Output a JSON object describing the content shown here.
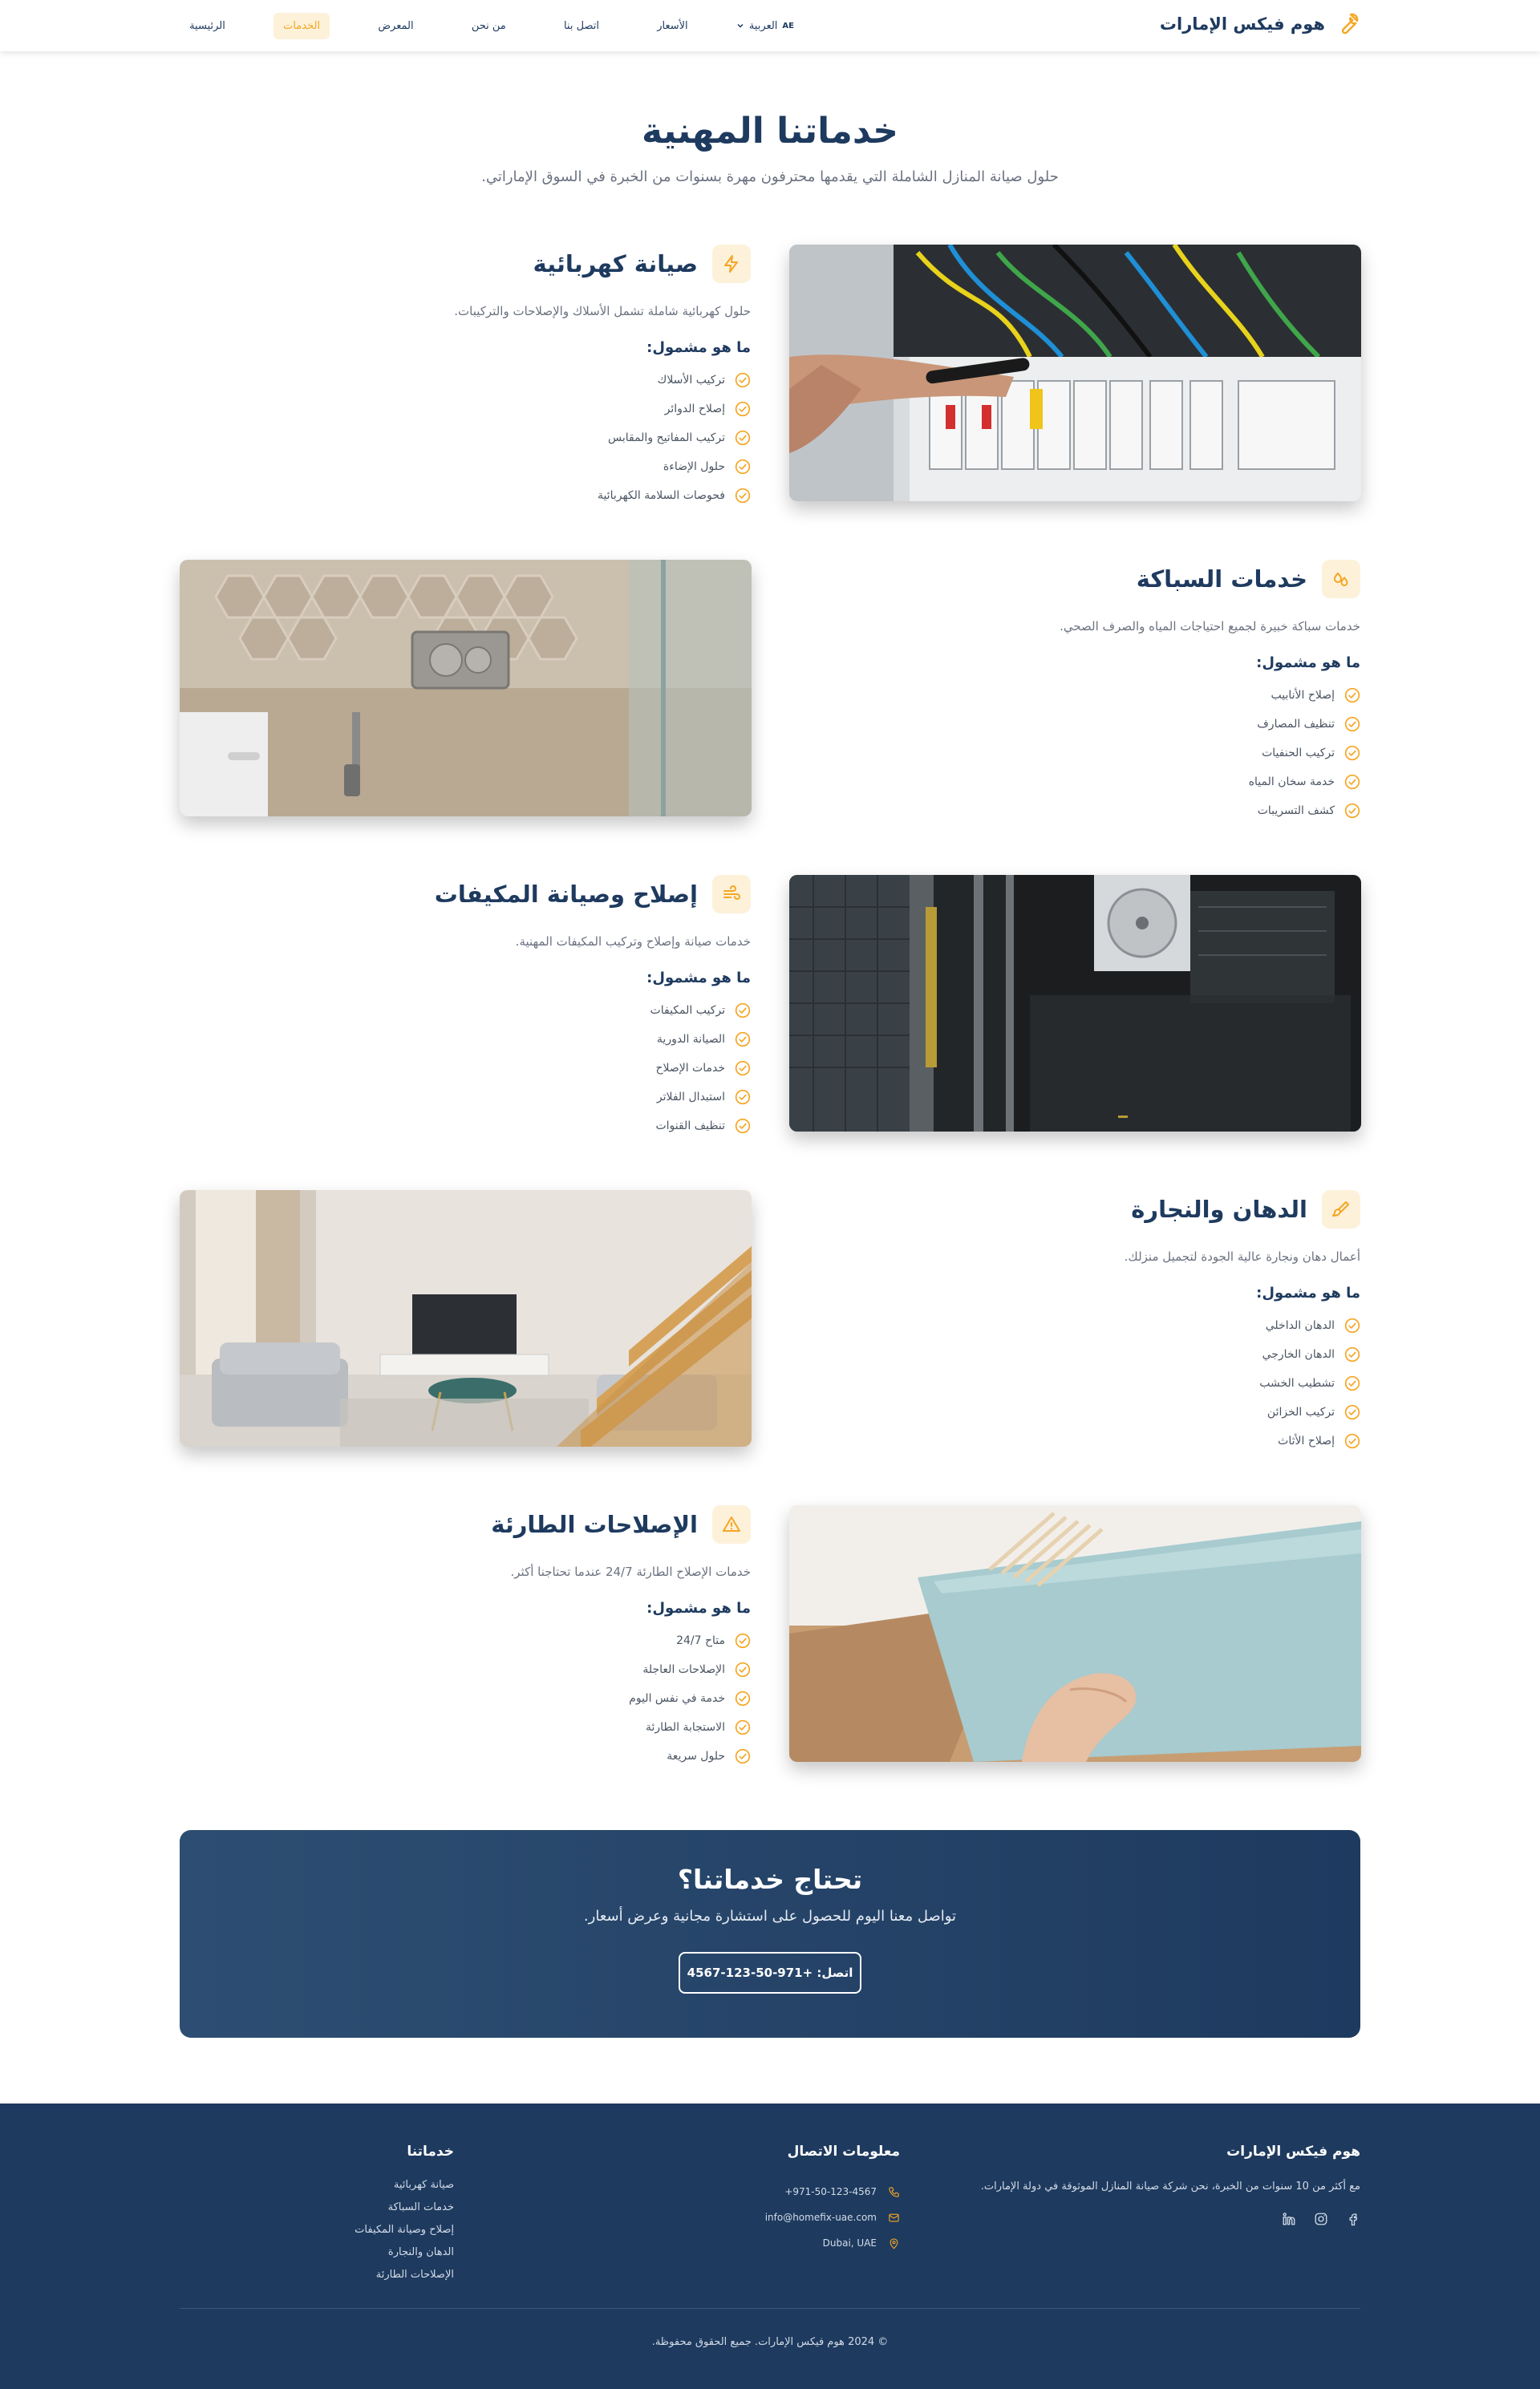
{
  "nav": {
    "brand": "هوم فيكس الإمارات",
    "items": [
      {
        "label": "الرئيسية"
      },
      {
        "label": "الخدمات"
      },
      {
        "label": "المعرض"
      },
      {
        "label": "من نحن"
      },
      {
        "label": "اتصل بنا"
      },
      {
        "label": "الأسعار"
      }
    ],
    "lang_code": "AE",
    "lang_label": "العربية"
  },
  "hero": {
    "title": "خدماتنا المهنية",
    "subtitle": "حلول صيانة المنازل الشاملة التي يقدمها محترفون مهرة بسنوات من الخبرة في السوق الإماراتي."
  },
  "includes_label": "ما هو مشمول:",
  "services": [
    {
      "title": "صيانة كهربائية",
      "desc": "حلول كهربائية شاملة تشمل الأسلاك والإصلاحات والتركيبات.",
      "icon": "lightning-icon",
      "items": [
        "تركيب الأسلاك",
        "إصلاح الدوائر",
        "تركيب المفاتيح والمقابس",
        "حلول الإضاءة",
        "فحوصات السلامة الكهربائية"
      ]
    },
    {
      "title": "خدمات السباكة",
      "desc": "خدمات سباكة خبيرة لجميع احتياجات المياه والصرف الصحي.",
      "icon": "droplets-icon",
      "items": [
        "إصلاح الأنابيب",
        "تنظيف المصارف",
        "تركيب الحنفيات",
        "خدمة سخان المياه",
        "كشف التسريبات"
      ]
    },
    {
      "title": "إصلاح وصيانة المكيفات",
      "desc": "خدمات صيانة وإصلاح وتركيب المكيفات المهنية.",
      "icon": "wind-icon",
      "items": [
        "تركيب المكيفات",
        "الصيانة الدورية",
        "خدمات الإصلاح",
        "استبدال الفلاتر",
        "تنظيف القنوات"
      ]
    },
    {
      "title": "الدهان والنجارة",
      "desc": "أعمال دهان ونجارة عالية الجودة لتجميل منزلك.",
      "icon": "paintbrush-icon",
      "items": [
        "الدهان الداخلي",
        "الدهان الخارجي",
        "تشطيب الخشب",
        "تركيب الخزائن",
        "إصلاح الأثاث"
      ]
    },
    {
      "title": "الإصلاحات الطارئة",
      "desc": "خدمات الإصلاح الطارئة 24/7 عندما تحتاجنا أكثر.",
      "icon": "warning-icon",
      "items": [
        "متاح 24/7",
        "الإصلاحات العاجلة",
        "خدمة في نفس اليوم",
        "الاستجابة الطارئة",
        "حلول سريعة"
      ]
    }
  ],
  "cta": {
    "title": "تحتاج خدماتنا؟",
    "subtitle": "تواصل معنا اليوم للحصول على استشارة مجانية وعرض أسعار.",
    "button": "اتصل: +971-50-123-4567"
  },
  "footer": {
    "about_title": "هوم فيكس الإمارات",
    "about_text": "مع أكثر من 10 سنوات من الخبرة، نحن شركة صيانة المنازل الموثوقة في دولة الإمارات.",
    "contact_title": "معلومات الاتصال",
    "phone": "+971-50-123-4567",
    "email": "info@homefix-uae.com",
    "location": "Dubai, UAE",
    "services_title": "خدماتنا",
    "services_links": [
      "صيانة كهربائية",
      "خدمات السباكة",
      "إصلاح وصيانة المكيفات",
      "الدهان والنجارة",
      "الإصلاحات الطارئة"
    ],
    "copyright": "© 2024 هوم فيكس الإمارات. جميع الحقوق محفوظة."
  },
  "colors": {
    "navy": "#1e3a5f",
    "accent": "#f5a623",
    "accent_bg": "#fdf1da",
    "muted": "#6b7280"
  }
}
